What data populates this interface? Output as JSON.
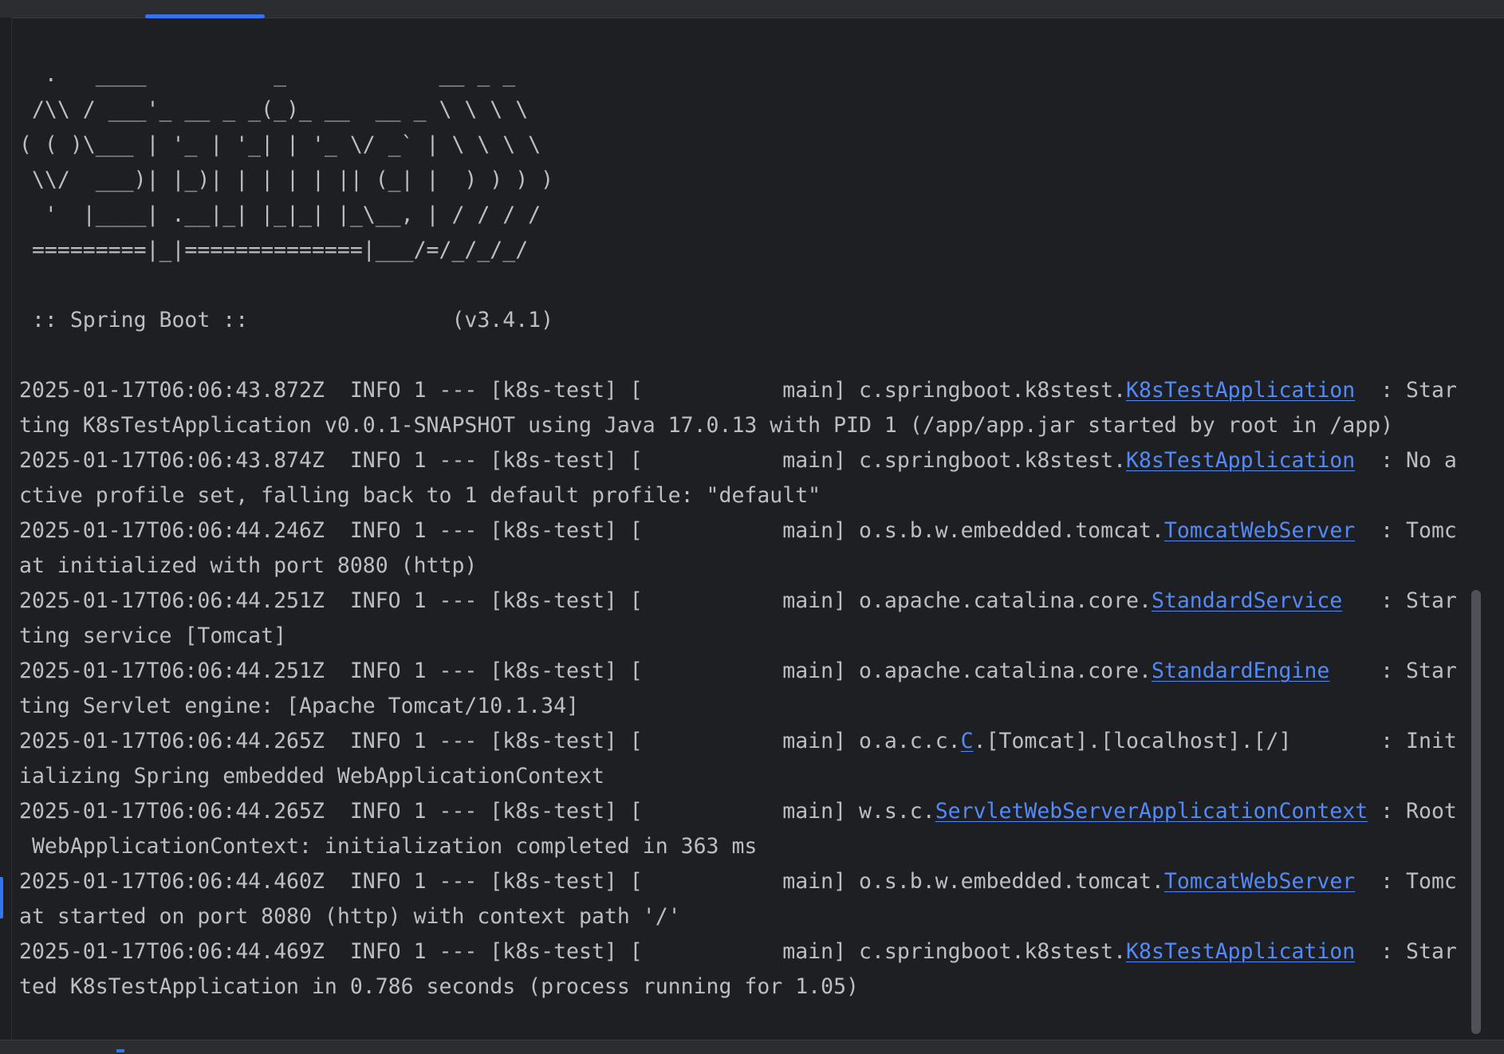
{
  "banner": [
    "  .   ____          _            __ _ _",
    " /\\\\ / ___'_ __ _ _(_)_ __  __ _ \\ \\ \\ \\",
    "( ( )\\___ | '_ | '_| | '_ \\/ _` | \\ \\ \\ \\",
    " \\\\/  ___)| |_)| | | | | || (_| |  ) ) ) )",
    "  '  |____| .__|_| |_|_| |_\\__, | / / / /",
    " =========|_|==============|___/=/_/_/_/",
    "",
    " :: Spring Boot ::                (v3.4.1)",
    ""
  ],
  "log_lines": [
    {
      "pre": "2025-01-17T06:06:43.872Z  INFO 1 --- [k8s-test] [           main] c.springboot.k8stest.",
      "link": "K8sTestApplication",
      "post": "  : Star"
    },
    {
      "pre": "ting K8sTestApplication v0.0.1-SNAPSHOT using Java 17.0.13 with PID 1 (/app/app.jar started by root in /app)"
    },
    {
      "pre": "2025-01-17T06:06:43.874Z  INFO 1 --- [k8s-test] [           main] c.springboot.k8stest.",
      "link": "K8sTestApplication",
      "post": "  : No a"
    },
    {
      "pre": "ctive profile set, falling back to 1 default profile: \"default\""
    },
    {
      "pre": "2025-01-17T06:06:44.246Z  INFO 1 --- [k8s-test] [           main] o.s.b.w.embedded.tomcat.",
      "link": "TomcatWebServer",
      "post": "  : Tomc"
    },
    {
      "pre": "at initialized with port 8080 (http)"
    },
    {
      "pre": "2025-01-17T06:06:44.251Z  INFO 1 --- [k8s-test] [           main] o.apache.catalina.core.",
      "link": "StandardService",
      "post": "   : Star"
    },
    {
      "pre": "ting service [Tomcat]"
    },
    {
      "pre": "2025-01-17T06:06:44.251Z  INFO 1 --- [k8s-test] [           main] o.apache.catalina.core.",
      "link": "StandardEngine",
      "post": "    : Star"
    },
    {
      "pre": "ting Servlet engine: [Apache Tomcat/10.1.34]"
    },
    {
      "pre": "2025-01-17T06:06:44.265Z  INFO 1 --- [k8s-test] [           main] o.a.c.c.",
      "link": "C",
      "post": ".[Tomcat].[localhost].[/]       : Init"
    },
    {
      "pre": "ializing Spring embedded WebApplicationContext"
    },
    {
      "pre": "2025-01-17T06:06:44.265Z  INFO 1 --- [k8s-test] [           main] w.s.c.",
      "link": "ServletWebServerApplicationContext",
      "post": " : Root"
    },
    {
      "pre": " WebApplicationContext: initialization completed in 363 ms"
    },
    {
      "pre": "2025-01-17T06:06:44.460Z  INFO 1 --- [k8s-test] [           main] o.s.b.w.embedded.tomcat.",
      "link": "TomcatWebServer",
      "post": "  : Tomc"
    },
    {
      "pre": "at started on port 8080 (http) with context path '/'"
    },
    {
      "pre": "2025-01-17T06:06:44.469Z  INFO 1 --- [k8s-test] [           main] c.springboot.k8stest.",
      "link": "K8sTestApplication",
      "post": "  : Star"
    },
    {
      "pre": "ted K8sTestApplication in 0.786 seconds (process running for 1.05)"
    }
  ]
}
